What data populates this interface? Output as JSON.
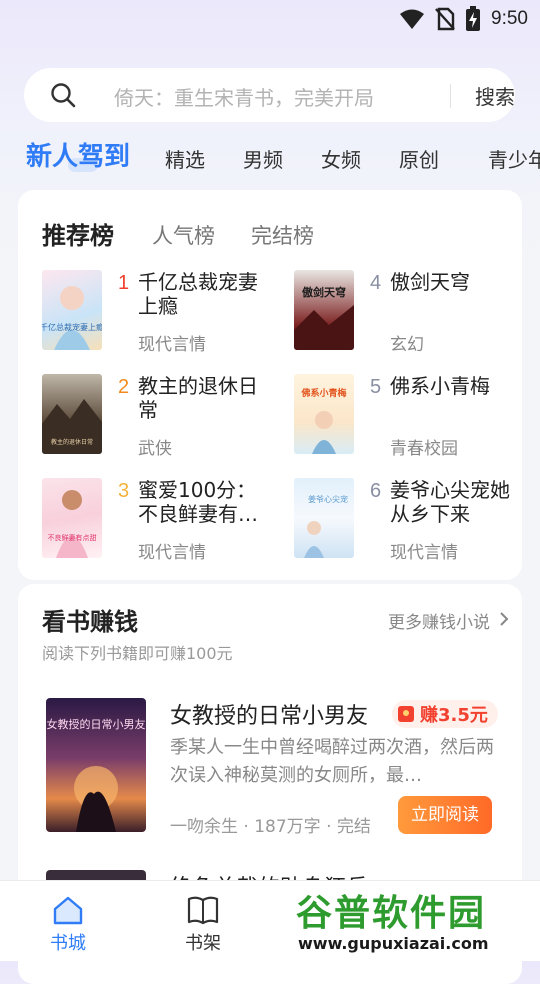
{
  "status_bar": {
    "time": "9:50"
  },
  "search": {
    "placeholder": "倚天：重生宋青书，完美开局",
    "button": "搜索"
  },
  "channel_tabs": [
    "新人驾到",
    "精选",
    "男频",
    "女频",
    "原创",
    "青少年"
  ],
  "ranking": {
    "tabs": [
      "推荐榜",
      "人气榜",
      "完结榜"
    ],
    "books": [
      {
        "rank": "1",
        "title": "千亿总裁宠妻上瘾",
        "genre": "现代言情",
        "cover_text": "千亿总裁宠妻上瘾"
      },
      {
        "rank": "2",
        "title": "教主的退休日常",
        "genre": "武侠",
        "cover_text": "教主的退休日常"
      },
      {
        "rank": "3",
        "title": "蜜爱100分：不良鲜妻有…",
        "genre": "现代言情",
        "cover_text": "不良鲜妻有点甜"
      },
      {
        "rank": "4",
        "title": "傲剑天穹",
        "genre": "玄幻",
        "cover_text": "傲剑天穹"
      },
      {
        "rank": "5",
        "title": "佛系小青梅",
        "genre": "青春校园",
        "cover_text": "佛系小青梅"
      },
      {
        "rank": "6",
        "title": "姜爷心尖宠她从乡下来",
        "genre": "现代言情",
        "cover_text": "姜爷心尖宠"
      }
    ]
  },
  "earn": {
    "title": "看书赚钱",
    "more": "更多赚钱小说",
    "subtitle": "阅读下列书籍即可赚100元",
    "featured": {
      "title": "女教授的日常小男友",
      "reward": "赚3.5元",
      "description": "季某人一生中曾经喝醉过两次酒，然后两次误入神秘莫测的女厕所，最…",
      "meta": "一吻余生 · 187万字 · 完结",
      "cover_text": "女教授的日常小男友",
      "button": "立即阅读"
    },
    "next_title": "绝色总裁的贴身狂兵"
  },
  "bottom_nav": [
    {
      "label": "书城",
      "icon": "home-icon",
      "active": true
    },
    {
      "label": "书架",
      "icon": "bookshelf-icon",
      "active": false
    }
  ],
  "watermark": {
    "main": "谷普软件园",
    "url": "www.gupuxiazai.com"
  },
  "colors": {
    "accent": "#2f7cf6",
    "reward": "#f2412f",
    "button_start": "#ff9a3c",
    "button_end": "#ff6a28"
  }
}
